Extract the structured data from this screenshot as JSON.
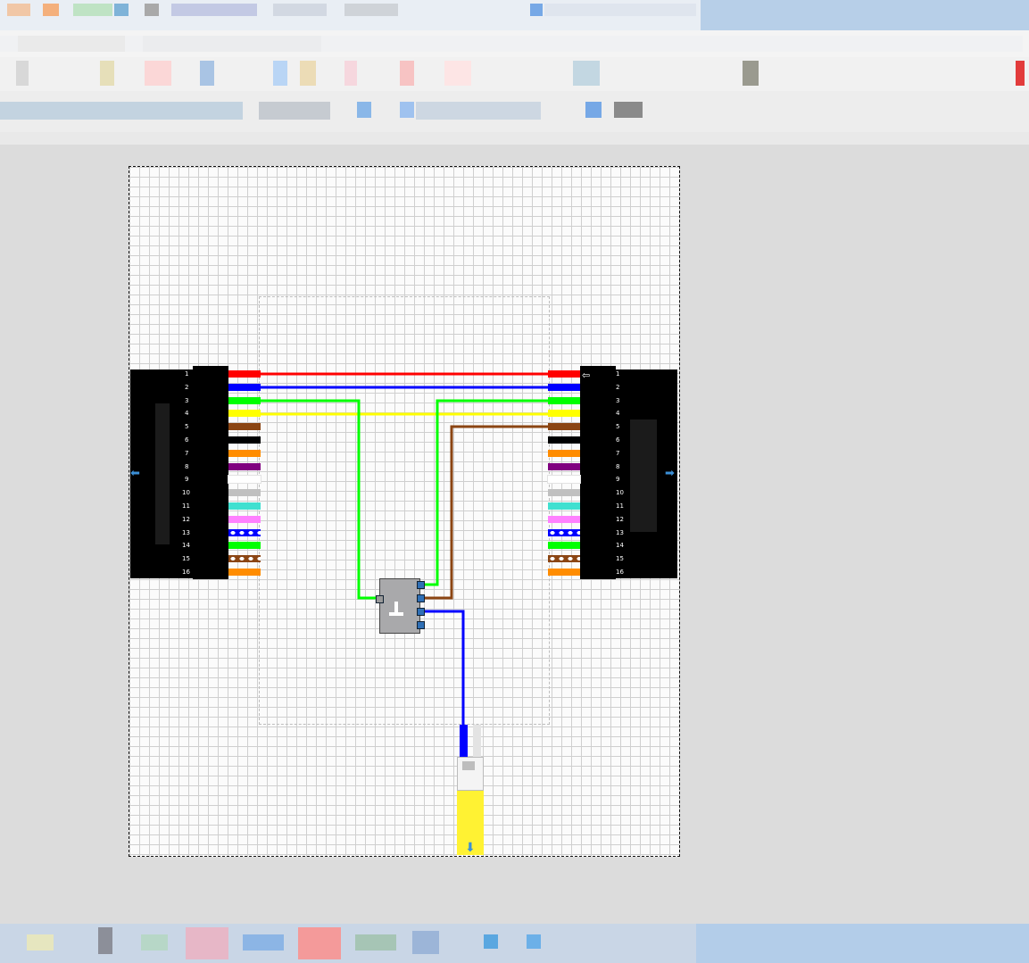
{
  "window": {
    "title_bar_color": "#b7cfe8",
    "status_bar_color": "#b3cde9"
  },
  "connectors": {
    "left": {
      "pin_numbers": [
        "1",
        "2",
        "3",
        "4",
        "5",
        "6",
        "7",
        "8",
        "9",
        "10",
        "11",
        "12",
        "13",
        "14",
        "15",
        "16"
      ]
    },
    "right": {
      "pin_numbers": [
        "1",
        "2",
        "3",
        "4",
        "5",
        "6",
        "7",
        "8",
        "9",
        "10",
        "11",
        "12",
        "13",
        "14",
        "15",
        "16"
      ]
    },
    "pin_colors": [
      "#ff0000",
      "#0000ff",
      "#00ff00",
      "#ffff00",
      "#8b4513",
      "#000000",
      "#ff8c00",
      "#800080",
      "#ffffff",
      "#c0c0c0",
      "#40e0d0",
      "#ff80ff",
      "#0000ff",
      "#00ff00",
      "#8b4513",
      "#ff8c00"
    ]
  },
  "icons": {
    "left_arrow": "arrow-left-icon",
    "right_arrow": "arrow-right-icon",
    "down_arrow": "arrow-down-icon",
    "splice_symbol": "splice-icon",
    "lamp_symbol": "lamp-icon"
  }
}
